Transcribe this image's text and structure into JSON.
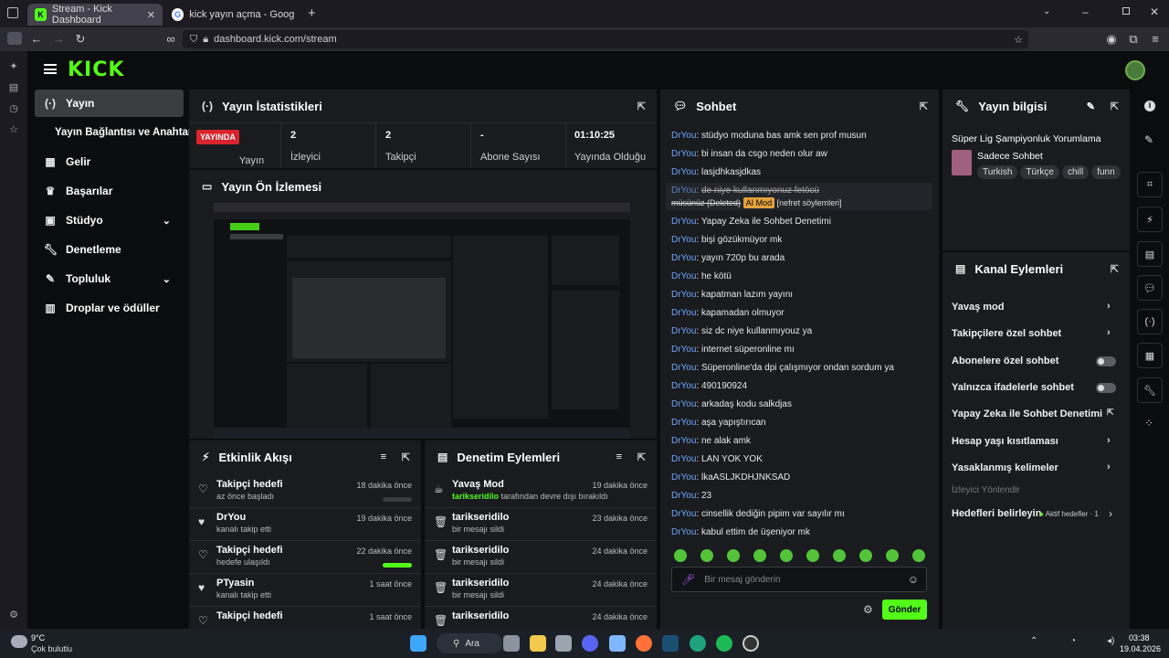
{
  "browser": {
    "tabs": [
      {
        "label": "Stream - Kick Dashboard",
        "active": true
      },
      {
        "label": "kick yayın açma - Google'da Ara",
        "active": false
      }
    ],
    "url": "dashboard.kick.com/stream"
  },
  "kick": {
    "logo": "KICK"
  },
  "sidebar": {
    "items": [
      {
        "label": "Yayın",
        "icon": "broadcast-icon"
      },
      {
        "label": "Yayın Bağlantısı ve Anahtarı"
      },
      {
        "label": "Gelir",
        "icon": "chart-icon"
      },
      {
        "label": "Başarılar",
        "icon": "trophy-icon"
      },
      {
        "label": "Stüdyo",
        "icon": "studio-icon"
      },
      {
        "label": "Denetleme",
        "icon": "wrench-icon"
      },
      {
        "label": "Topluluk",
        "icon": "community-icon"
      },
      {
        "label": "Droplar ve ödüller",
        "icon": "drops-icon"
      }
    ]
  },
  "stats": {
    "title": "Yayın İstatistikleri",
    "live_badge": "YAYINDA",
    "live_label": "Yayın",
    "viewers": "2",
    "viewers_label": "İzleyici",
    "followers": "2",
    "followers_label": "Takipçi",
    "subs": "-",
    "subs_label": "Abone Sayısı",
    "uptime": "01:10:25",
    "uptime_label": "Yayında Olduğu"
  },
  "preview": {
    "title": "Yayın Ön İzlemesi"
  },
  "activity": {
    "title": "Etkinlik Akışı",
    "items": [
      {
        "title": "Takipçi hedefi",
        "sub": "az önce başladı",
        "time": "18 dakika önce",
        "progress": 0
      },
      {
        "title": "DrYou",
        "sub": "kanalı takip etti",
        "time": "19 dakika önce"
      },
      {
        "title": "Takipçi hedefi",
        "sub": "hedefe ulaşıldı",
        "time": "22 dakika önce",
        "progress": 1
      },
      {
        "title": "PTyasin",
        "sub": "kanalı takip etti",
        "time": "1 saat önce"
      },
      {
        "title": "Takipçi hedefi",
        "sub": "",
        "time": "1 saat önce"
      }
    ]
  },
  "modlog": {
    "title": "Denetim Eylemleri",
    "items": [
      {
        "title": "Yavaş Mod",
        "user": "tarikseridilo",
        "sub": "tarafından devre dışı bırakıldı",
        "time": "19 dakika önce"
      },
      {
        "title": "tarikseridilo",
        "sub": "bir mesajı sildi",
        "time": "23 dakika önce"
      },
      {
        "title": "tarikseridilo",
        "sub": "bir mesajı sildi",
        "time": "24 dakika önce"
      },
      {
        "title": "tarikseridilo",
        "sub": "bir mesajı sildi",
        "time": "24 dakika önce"
      },
      {
        "title": "tarikseridilo",
        "sub": "bir mesajı sildi",
        "time": "24 dakika önce"
      }
    ]
  },
  "chat": {
    "title": "Sohbet",
    "user": "DrYou",
    "messages": [
      "stüdyo moduna bas amk sen prof musun",
      "bi insan da csgo neden olur aw",
      "lasjdhkasjdkas",
      "de niye kullanmıyonuz fetöcü",
      "Yapay Zeka ile Sohbet Denetimi",
      "bişi gözükmüyor mk",
      "yayın 720p bu arada",
      "he kötü",
      "kapatman lazım yayını",
      "kapamadan olmuyor",
      "siz dc niye kullanmıyouz ya",
      "internet süperonline mı",
      "Süperonline'da dpi çalışmıyor ondan sordum ya",
      "490190924",
      "arkadaş kodu salkdjas",
      "aşa yapıştırıcan",
      "ne alak amk",
      "LAN YOK YOK",
      "lkaASLJKDHJNKSAD",
      "23",
      "cinsellik dediğin pipim var sayılır mı",
      "kabul ettim de üşeniyor mk"
    ],
    "deleted_line": "müsünüz (Deleted)",
    "ai_badge": "AI Mod",
    "deleted_reason": "[nefret söylemleri]",
    "input_placeholder": "Bir mesaj gönderin",
    "send": "Gönder"
  },
  "info": {
    "title": "Yayın bilgisi",
    "stream_title": "Süper Lig Şampiyonluk Yorumlama",
    "category": "Sadece Sohbet",
    "tags": [
      "Turkish",
      "Türkçe",
      "chill",
      "funn"
    ]
  },
  "channel": {
    "title": "Kanal Eylemleri",
    "slow": "Yavaş mod",
    "followers_only": "Takipçilere özel sohbet",
    "subs_only": "Abonelere özel sohbet",
    "emotes_only": "Yalnızca ifadelerle sohbet",
    "ai_mod": "Yapay Zeka ile Sohbet Denetimi",
    "age": "Hesap yaşı kısıtlaması",
    "banned_words": "Yasaklanmış kelimeler",
    "raid_section": "İzleyici Yönlendir",
    "goals": "Hedefleri belirleyin",
    "goals_status": "Aktif hedefler · 1"
  },
  "taskbar": {
    "weather_temp": "9°C",
    "weather_desc": "Çok bulutlu",
    "search": "Ara",
    "time": "03:38",
    "date": "19.04.2026"
  },
  "colors": {
    "brand": "#53fc18",
    "live": "#d9232d",
    "username": "#6fa8ff"
  }
}
